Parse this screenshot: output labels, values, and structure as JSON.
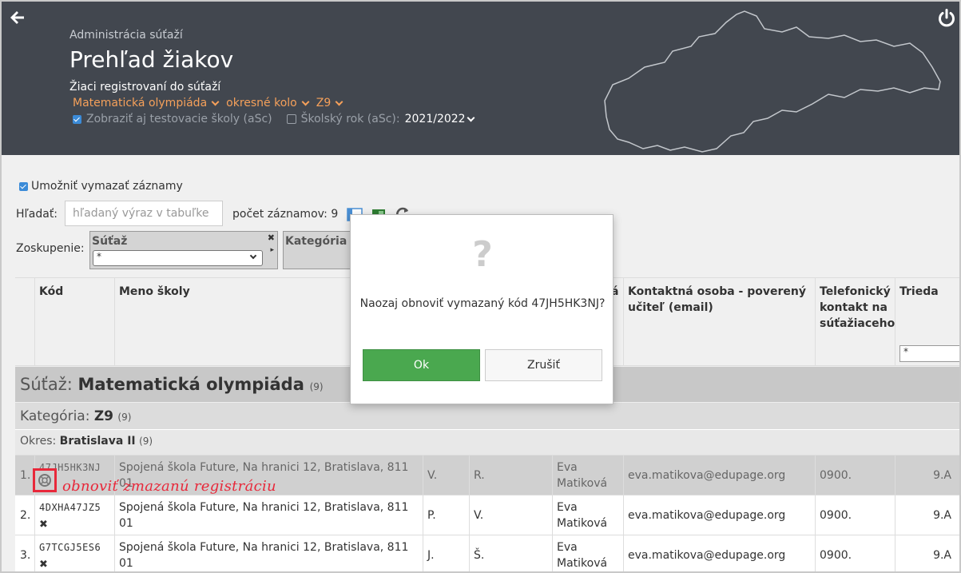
{
  "header": {
    "breadcrumb": "Administrácia súťaží",
    "title": "Prehľad žiakov",
    "description": "Žiaci registrovaní do súťaží",
    "filters": [
      "Matematická olympiáda",
      "okresné kolo",
      "Z9"
    ],
    "show_test_schools": "Zobraziť aj testovacie školy (aSc)",
    "school_year_label": "Školský rok (aSc):",
    "school_year_value": "2021/2022"
  },
  "toolbar": {
    "allow_delete": "Umožniť vymazať záznamy",
    "search_label": "Hľadať:",
    "search_placeholder": "hľadaný výraz v tabuľke",
    "count": "počet záznamov: 9",
    "grouping_label": "Zoskupenie:",
    "group1_title": "Súťaž",
    "group1_value": "*",
    "group2_title": "Kategória"
  },
  "table": {
    "headers": {
      "code": "Kód",
      "school": "Meno školy",
      "partial": "á",
      "contact": "Kontaktná osoba - poverený učiteľ (email)",
      "phone": "Telefonický kontakt na súťažiaceho",
      "class": "Trieda"
    },
    "class_filter": "*",
    "group_competition": {
      "label": "Súťaž:",
      "value": "Matematická olympiáda",
      "count": "(9)"
    },
    "group_category": {
      "label": "Kategória:",
      "value": "Z9",
      "count": "(9)"
    },
    "group_district": {
      "label": "Okres:",
      "value": "Bratislava II",
      "count": "(9)"
    },
    "rows": [
      {
        "num": "1.",
        "code": "47JH5HK3NJ",
        "school": "Spojená škola Future, Na hranici 12, Bratislava, 811 01",
        "first": "V.",
        "last": "R.",
        "teacher": "Eva Matiková",
        "email": "eva.matikova@edupage.org",
        "phone": "0900.",
        "class": "9.A"
      },
      {
        "num": "2.",
        "code": "4DXHA47JZ5",
        "school": "Spojená škola Future, Na hranici 12, Bratislava, 811 01",
        "first": "P.",
        "last": "V.",
        "teacher": "Eva Matiková",
        "email": "eva.matikova@edupage.org",
        "phone": "0900.",
        "class": "9.A"
      },
      {
        "num": "3.",
        "code": "G7TCGJ5ES6",
        "school": "Spojená škola Future, Na hranici 12, Bratislava, 811 01",
        "first": "J.",
        "last": "Š.",
        "teacher": "Eva Matiková",
        "email": "eva.matikova@edupage.org",
        "phone": "0900.",
        "class": "9.A"
      }
    ],
    "delete_symbol": "✖"
  },
  "annotation": "obnoviť zmazanú registráciu",
  "dialog": {
    "icon": "?",
    "message": "Naozaj obnoviť vymazaný kód 47JH5HK3NJ?",
    "ok": "Ok",
    "cancel": "Zrušiť"
  },
  "colors": {
    "header_bg": "#42474f",
    "accent_orange": "#f5a05a",
    "ok_green": "#4aa84f",
    "annotation_red": "#e8283a"
  }
}
